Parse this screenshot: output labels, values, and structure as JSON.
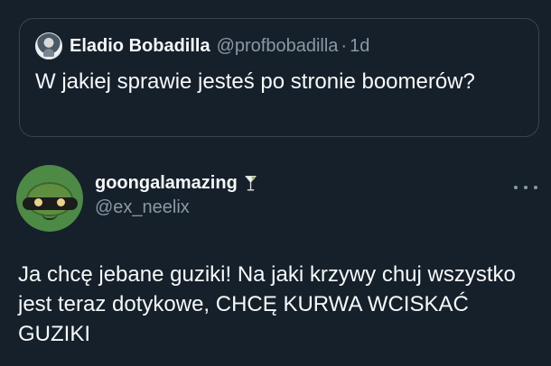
{
  "quoted_tweet": {
    "author_name": "Eladio Bobadilla",
    "author_handle": "@profbobadilla",
    "separator": "·",
    "age": "1d",
    "text": "W jakiej sprawie jesteś po stronie boomerów?"
  },
  "tweet": {
    "author_name": "goongalamazing",
    "author_handle": "@ex_neelix",
    "emoji_icon": "cocktail-glass-icon",
    "text": "Ja chcę jebane guziki! Na jaki krzywy chuj wszystko jest teraz dotykowe, CHCĘ KURWA WCISKAĆ GUZIKI"
  },
  "icons": {
    "quoted_avatar": "profile-avatar-icon",
    "main_avatar": "turtle-avatar-icon",
    "more": "more-options-icon"
  },
  "colors": {
    "background": "#15202b",
    "border": "#38444d",
    "primary_text": "#f7f9f9",
    "secondary_text": "#8b98a5"
  }
}
